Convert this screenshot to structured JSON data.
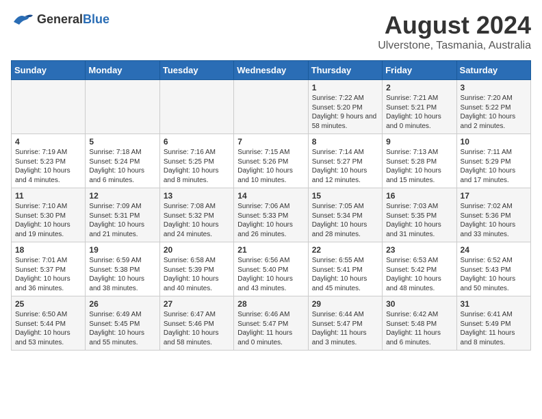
{
  "header": {
    "logo_general": "General",
    "logo_blue": "Blue",
    "month_title": "August 2024",
    "location": "Ulverstone, Tasmania, Australia"
  },
  "calendar": {
    "days_of_week": [
      "Sunday",
      "Monday",
      "Tuesday",
      "Wednesday",
      "Thursday",
      "Friday",
      "Saturday"
    ],
    "weeks": [
      [
        {
          "day": "",
          "info": ""
        },
        {
          "day": "",
          "info": ""
        },
        {
          "day": "",
          "info": ""
        },
        {
          "day": "",
          "info": ""
        },
        {
          "day": "1",
          "info": "Sunrise: 7:22 AM\nSunset: 5:20 PM\nDaylight: 9 hours and 58 minutes."
        },
        {
          "day": "2",
          "info": "Sunrise: 7:21 AM\nSunset: 5:21 PM\nDaylight: 10 hours and 0 minutes."
        },
        {
          "day": "3",
          "info": "Sunrise: 7:20 AM\nSunset: 5:22 PM\nDaylight: 10 hours and 2 minutes."
        }
      ],
      [
        {
          "day": "4",
          "info": "Sunrise: 7:19 AM\nSunset: 5:23 PM\nDaylight: 10 hours and 4 minutes."
        },
        {
          "day": "5",
          "info": "Sunrise: 7:18 AM\nSunset: 5:24 PM\nDaylight: 10 hours and 6 minutes."
        },
        {
          "day": "6",
          "info": "Sunrise: 7:16 AM\nSunset: 5:25 PM\nDaylight: 10 hours and 8 minutes."
        },
        {
          "day": "7",
          "info": "Sunrise: 7:15 AM\nSunset: 5:26 PM\nDaylight: 10 hours and 10 minutes."
        },
        {
          "day": "8",
          "info": "Sunrise: 7:14 AM\nSunset: 5:27 PM\nDaylight: 10 hours and 12 minutes."
        },
        {
          "day": "9",
          "info": "Sunrise: 7:13 AM\nSunset: 5:28 PM\nDaylight: 10 hours and 15 minutes."
        },
        {
          "day": "10",
          "info": "Sunrise: 7:11 AM\nSunset: 5:29 PM\nDaylight: 10 hours and 17 minutes."
        }
      ],
      [
        {
          "day": "11",
          "info": "Sunrise: 7:10 AM\nSunset: 5:30 PM\nDaylight: 10 hours and 19 minutes."
        },
        {
          "day": "12",
          "info": "Sunrise: 7:09 AM\nSunset: 5:31 PM\nDaylight: 10 hours and 21 minutes."
        },
        {
          "day": "13",
          "info": "Sunrise: 7:08 AM\nSunset: 5:32 PM\nDaylight: 10 hours and 24 minutes."
        },
        {
          "day": "14",
          "info": "Sunrise: 7:06 AM\nSunset: 5:33 PM\nDaylight: 10 hours and 26 minutes."
        },
        {
          "day": "15",
          "info": "Sunrise: 7:05 AM\nSunset: 5:34 PM\nDaylight: 10 hours and 28 minutes."
        },
        {
          "day": "16",
          "info": "Sunrise: 7:03 AM\nSunset: 5:35 PM\nDaylight: 10 hours and 31 minutes."
        },
        {
          "day": "17",
          "info": "Sunrise: 7:02 AM\nSunset: 5:36 PM\nDaylight: 10 hours and 33 minutes."
        }
      ],
      [
        {
          "day": "18",
          "info": "Sunrise: 7:01 AM\nSunset: 5:37 PM\nDaylight: 10 hours and 36 minutes."
        },
        {
          "day": "19",
          "info": "Sunrise: 6:59 AM\nSunset: 5:38 PM\nDaylight: 10 hours and 38 minutes."
        },
        {
          "day": "20",
          "info": "Sunrise: 6:58 AM\nSunset: 5:39 PM\nDaylight: 10 hours and 40 minutes."
        },
        {
          "day": "21",
          "info": "Sunrise: 6:56 AM\nSunset: 5:40 PM\nDaylight: 10 hours and 43 minutes."
        },
        {
          "day": "22",
          "info": "Sunrise: 6:55 AM\nSunset: 5:41 PM\nDaylight: 10 hours and 45 minutes."
        },
        {
          "day": "23",
          "info": "Sunrise: 6:53 AM\nSunset: 5:42 PM\nDaylight: 10 hours and 48 minutes."
        },
        {
          "day": "24",
          "info": "Sunrise: 6:52 AM\nSunset: 5:43 PM\nDaylight: 10 hours and 50 minutes."
        }
      ],
      [
        {
          "day": "25",
          "info": "Sunrise: 6:50 AM\nSunset: 5:44 PM\nDaylight: 10 hours and 53 minutes."
        },
        {
          "day": "26",
          "info": "Sunrise: 6:49 AM\nSunset: 5:45 PM\nDaylight: 10 hours and 55 minutes."
        },
        {
          "day": "27",
          "info": "Sunrise: 6:47 AM\nSunset: 5:46 PM\nDaylight: 10 hours and 58 minutes."
        },
        {
          "day": "28",
          "info": "Sunrise: 6:46 AM\nSunset: 5:47 PM\nDaylight: 11 hours and 0 minutes."
        },
        {
          "day": "29",
          "info": "Sunrise: 6:44 AM\nSunset: 5:47 PM\nDaylight: 11 hours and 3 minutes."
        },
        {
          "day": "30",
          "info": "Sunrise: 6:42 AM\nSunset: 5:48 PM\nDaylight: 11 hours and 6 minutes."
        },
        {
          "day": "31",
          "info": "Sunrise: 6:41 AM\nSunset: 5:49 PM\nDaylight: 11 hours and 8 minutes."
        }
      ]
    ]
  }
}
